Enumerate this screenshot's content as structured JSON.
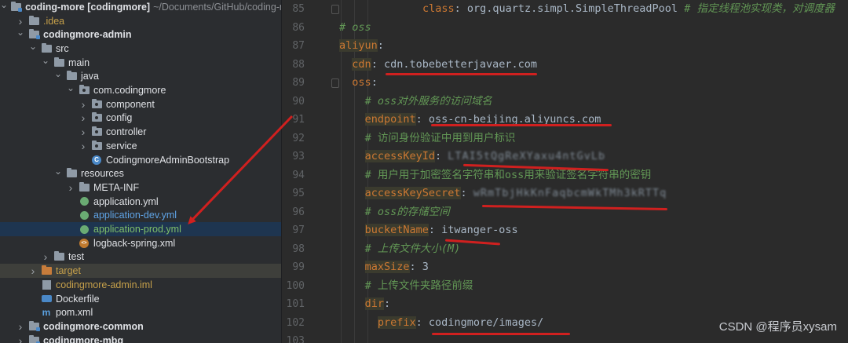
{
  "tree": {
    "rows": [
      {
        "label": "coding-more [codingmore]",
        "extra": "~/Documents/GitHub/coding-m",
        "depth": 0,
        "open": true,
        "icon": "module-folder",
        "bold": true
      },
      {
        "label": ".idea",
        "depth": 1,
        "open": false,
        "icon": "folder",
        "color": "idea"
      },
      {
        "label": "codingmore-admin",
        "depth": 1,
        "open": true,
        "icon": "module-folder",
        "bold": true
      },
      {
        "label": "src",
        "depth": 2,
        "open": true,
        "icon": "folder"
      },
      {
        "label": "main",
        "depth": 3,
        "open": true,
        "icon": "folder"
      },
      {
        "label": "java",
        "depth": 4,
        "open": true,
        "icon": "folder"
      },
      {
        "label": "com.codingmore",
        "depth": 5,
        "open": true,
        "icon": "package"
      },
      {
        "label": "component",
        "depth": 6,
        "open": false,
        "icon": "package"
      },
      {
        "label": "config",
        "depth": 6,
        "open": false,
        "icon": "package"
      },
      {
        "label": "controller",
        "depth": 6,
        "open": false,
        "icon": "package"
      },
      {
        "label": "service",
        "depth": 6,
        "open": false,
        "icon": "package"
      },
      {
        "label": "CodingmoreAdminBootstrap",
        "depth": 6,
        "icon": "class"
      },
      {
        "label": "resources",
        "depth": 4,
        "open": true,
        "icon": "folder"
      },
      {
        "label": "META-INF",
        "depth": 5,
        "open": false,
        "icon": "folder"
      },
      {
        "label": "application.yml",
        "depth": 5,
        "icon": "yaml"
      },
      {
        "label": "application-dev.yml",
        "depth": 5,
        "icon": "yaml",
        "color": "blue"
      },
      {
        "label": "application-prod.yml",
        "depth": 5,
        "icon": "yaml",
        "color": "green",
        "selected": true
      },
      {
        "label": "logback-spring.xml",
        "depth": 5,
        "icon": "xml"
      },
      {
        "label": "test",
        "depth": 3,
        "open": false,
        "icon": "folder"
      },
      {
        "label": "target",
        "depth": 2,
        "open": false,
        "icon": "orange-folder",
        "color": "target",
        "highlight": true
      },
      {
        "label": "codingmore-admin.iml",
        "depth": 2,
        "icon": "iml",
        "color": "iml"
      },
      {
        "label": "Dockerfile",
        "depth": 2,
        "icon": "docker"
      },
      {
        "label": "pom.xml",
        "depth": 2,
        "icon": "maven"
      },
      {
        "label": "codingmore-common",
        "depth": 1,
        "open": false,
        "icon": "module-folder",
        "bold": true
      },
      {
        "label": "codingmore-mbg",
        "depth": 1,
        "open": false,
        "icon": "module-folder",
        "bold": true
      }
    ]
  },
  "editor": {
    "lines": [
      {
        "num": "85",
        "indent": 13,
        "parts": [
          [
            "key",
            "class"
          ],
          [
            "val",
            ": org.quartz.simpl.SimpleThreadPool "
          ],
          [
            "cm",
            "# 指定线程池实现类，对调度器"
          ]
        ]
      },
      {
        "num": "86",
        "indent": 0,
        "parts": [
          [
            "cm",
            "# oss"
          ]
        ]
      },
      {
        "num": "87",
        "indent": 0,
        "parts": [
          [
            "keybg",
            "aliyun"
          ],
          [
            "val",
            ":"
          ]
        ]
      },
      {
        "num": "88",
        "indent": 2,
        "parts": [
          [
            "keybg",
            "cdn"
          ],
          [
            "val",
            ": cdn.tobebetterjavaer.com"
          ]
        ]
      },
      {
        "num": "89",
        "indent": 2,
        "parts": [
          [
            "key",
            "oss"
          ],
          [
            "val",
            ":"
          ]
        ]
      },
      {
        "num": "90",
        "indent": 4,
        "parts": [
          [
            "cm",
            "# oss对外服务的访问域名"
          ]
        ]
      },
      {
        "num": "91",
        "indent": 4,
        "parts": [
          [
            "keybg",
            "endpoint"
          ],
          [
            "val",
            ": oss-cn-beijing.aliyuncs.com"
          ]
        ]
      },
      {
        "num": "92",
        "indent": 4,
        "parts": [
          [
            "cmn",
            "# 访问身份验证中用到用户标识"
          ]
        ]
      },
      {
        "num": "93",
        "indent": 4,
        "parts": [
          [
            "keybg",
            "accessKeyId"
          ],
          [
            "val",
            ": "
          ],
          [
            "blur",
            "LTAI5tQgReXYaxu4ntGvLb"
          ]
        ]
      },
      {
        "num": "94",
        "indent": 4,
        "parts": [
          [
            "cmn",
            "# 用户用于加密签名字符串和oss用来验证签名字符串的密钥"
          ]
        ]
      },
      {
        "num": "95",
        "indent": 4,
        "parts": [
          [
            "keybg",
            "accessKeySecret"
          ],
          [
            "val",
            ": "
          ],
          [
            "blur",
            "wRmTbjHkKnFaqbcmWkTMh3kRTTq"
          ]
        ]
      },
      {
        "num": "96",
        "indent": 4,
        "parts": [
          [
            "cm",
            "# oss的存储空间"
          ]
        ]
      },
      {
        "num": "97",
        "indent": 4,
        "parts": [
          [
            "keybg",
            "bucketName"
          ],
          [
            "val",
            ": itwanger-oss"
          ]
        ]
      },
      {
        "num": "98",
        "indent": 4,
        "parts": [
          [
            "cm",
            "# 上传文件大小(M)"
          ]
        ]
      },
      {
        "num": "99",
        "indent": 4,
        "parts": [
          [
            "keybg",
            "maxSize"
          ],
          [
            "val",
            ": "
          ],
          [
            "val",
            "3"
          ]
        ]
      },
      {
        "num": "100",
        "indent": 4,
        "parts": [
          [
            "cmn",
            "# 上传文件夹路径前缀"
          ]
        ]
      },
      {
        "num": "101",
        "indent": 4,
        "parts": [
          [
            "keybg",
            "dir"
          ],
          [
            "val",
            ":"
          ]
        ]
      },
      {
        "num": "102",
        "indent": 6,
        "parts": [
          [
            "keybg",
            "prefix"
          ],
          [
            "val",
            ": codingmore/images/"
          ]
        ]
      }
    ],
    "partial_line_number": "103"
  },
  "watermark": "CSDN @程序员xysam",
  "colors": {
    "annotation": "#d0201f",
    "selection": "#1e3550"
  }
}
